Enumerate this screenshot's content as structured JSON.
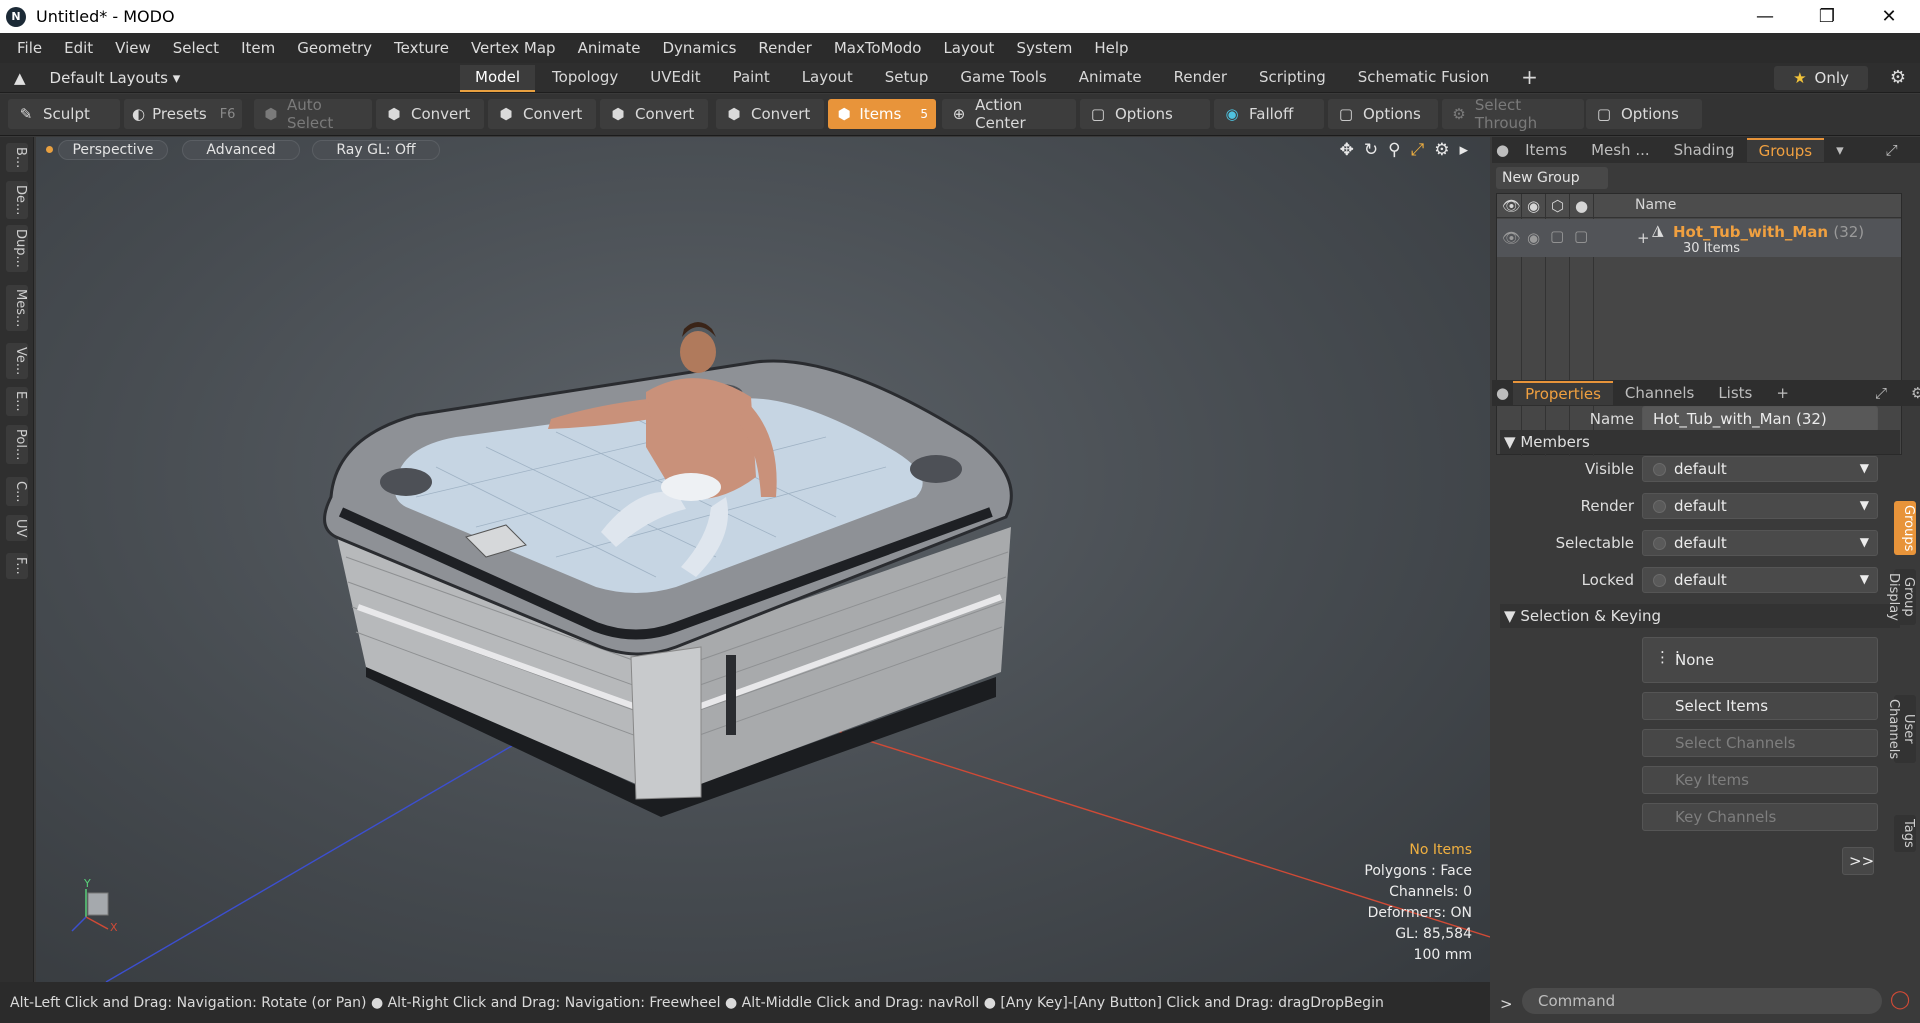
{
  "window": {
    "title": "Untitled* - MODO",
    "logo": "N"
  },
  "menu": [
    "File",
    "Edit",
    "View",
    "Select",
    "Item",
    "Geometry",
    "Texture",
    "Vertex Map",
    "Animate",
    "Dynamics",
    "Render",
    "MaxToModo",
    "Layout",
    "System",
    "Help"
  ],
  "layout_selector": {
    "label": "Default Layouts"
  },
  "tabs": [
    "Model",
    "Topology",
    "UVEdit",
    "Paint",
    "Layout",
    "Setup",
    "Game Tools",
    "Animate",
    "Render",
    "Scripting",
    "Schematic Fusion"
  ],
  "only_label": "Only",
  "toolbar": {
    "sculpt": "Sculpt",
    "presets": "Presets",
    "presets_key": "F6",
    "auto_select": "Auto Select",
    "convert": "Convert",
    "items": "Items",
    "items_badge": "5",
    "action_center": "Action Center",
    "options": "Options",
    "falloff": "Falloff",
    "select_through": "Select Through"
  },
  "left_tabs": [
    "B...",
    "De...",
    "Dup...",
    "Mes...",
    "Ve...",
    "E...",
    "Pol...",
    "C...",
    "UV",
    "F..."
  ],
  "viewport": {
    "perspective": "Perspective",
    "advanced": "Advanced",
    "raygl": "Ray GL: Off",
    "info": {
      "items": "No Items",
      "polygons": "Polygons : Face",
      "channels": "Channels: 0",
      "deformers": "Deformers: ON",
      "gl": "GL: 85,584",
      "units": "100 mm"
    },
    "axis_y": "Y",
    "axis_x": "X"
  },
  "status": "Alt-Left Click and Drag: Navigation: Rotate (or Pan) ●  Alt-Right Click and Drag: Navigation: Freewheel ●  Alt-Middle Click and Drag: navRoll ●  [Any Key]-[Any Button] Click and Drag: dragDropBegin",
  "right_tabs": [
    "Items",
    "Mesh ...",
    "Shading",
    "Groups"
  ],
  "groups": {
    "new_group": "New Group",
    "name_col": "Name",
    "row": {
      "name": "Hot_Tub_with_Man",
      "count": "(32)",
      "sub": "30 Items"
    }
  },
  "props_tabs": [
    "Properties",
    "Channels",
    "Lists"
  ],
  "props": {
    "name_label": "Name",
    "name_value": "Hot_Tub_with_Man (32)",
    "members": "Members",
    "visible_label": "Visible",
    "render_label": "Render",
    "selectable_label": "Selectable",
    "locked_label": "Locked",
    "default": "default",
    "sel_keying": "Selection & Keying",
    "none": "None",
    "select_items": "Select Items",
    "select_channels": "Select Channels",
    "key_items": "Key Items",
    "key_channels": "Key Channels",
    "more": ">>"
  },
  "right_vtabs": [
    "Groups",
    "Group Display",
    "User Channels",
    "Tags"
  ],
  "command_placeholder": "Command"
}
